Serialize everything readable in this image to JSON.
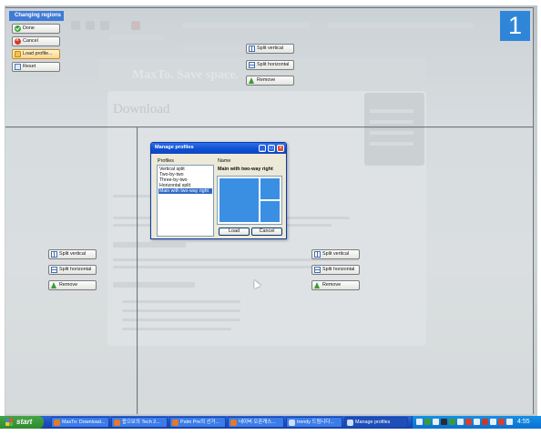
{
  "changing_regions": {
    "title": "Changing regions",
    "buttons": {
      "done": "Done",
      "cancel": "Cancel",
      "load_profile": "Load profile...",
      "reset": "Reset"
    }
  },
  "region_controls": {
    "split_vertical": "Split vertical",
    "split_horizontal": "Split horizontal",
    "remove": "Remove"
  },
  "region_number": "1",
  "dialog": {
    "title": "Manage profiles",
    "profiles_label": "Profiles",
    "name_label": "Name",
    "profiles": [
      "Vertical split",
      "Two-by-two",
      "Three-by-two",
      "Horizontal split",
      "Main with two-way right"
    ],
    "selected_index": 4,
    "name_value": "Main with two-way right",
    "load_button": "Load",
    "cancel_button": "Cancel",
    "title_buttons": {
      "minimize": "_",
      "maximize": "□",
      "close": "×"
    }
  },
  "background": {
    "hero_text": "MaxTo. Save space.",
    "heading": "Download"
  },
  "taskbar": {
    "start": "start",
    "tasks": [
      {
        "label": "MaxTo: Download...",
        "active": false
      },
      {
        "label": "팝으보의 Tech 2...",
        "active": false
      },
      {
        "label": "Palm Pre의 선거...",
        "active": false
      },
      {
        "label": "네이버 오픈캐스...",
        "active": false
      },
      {
        "label": "trendy 드림니다...",
        "active": false
      },
      {
        "label": "Manage profiles",
        "active": true
      }
    ],
    "clock": "4:55"
  },
  "colors": {
    "accent": "#2f86d8",
    "taskbar": "#245edb",
    "start": "#3a9a3a",
    "preview_fill": "#3b8fe3"
  }
}
